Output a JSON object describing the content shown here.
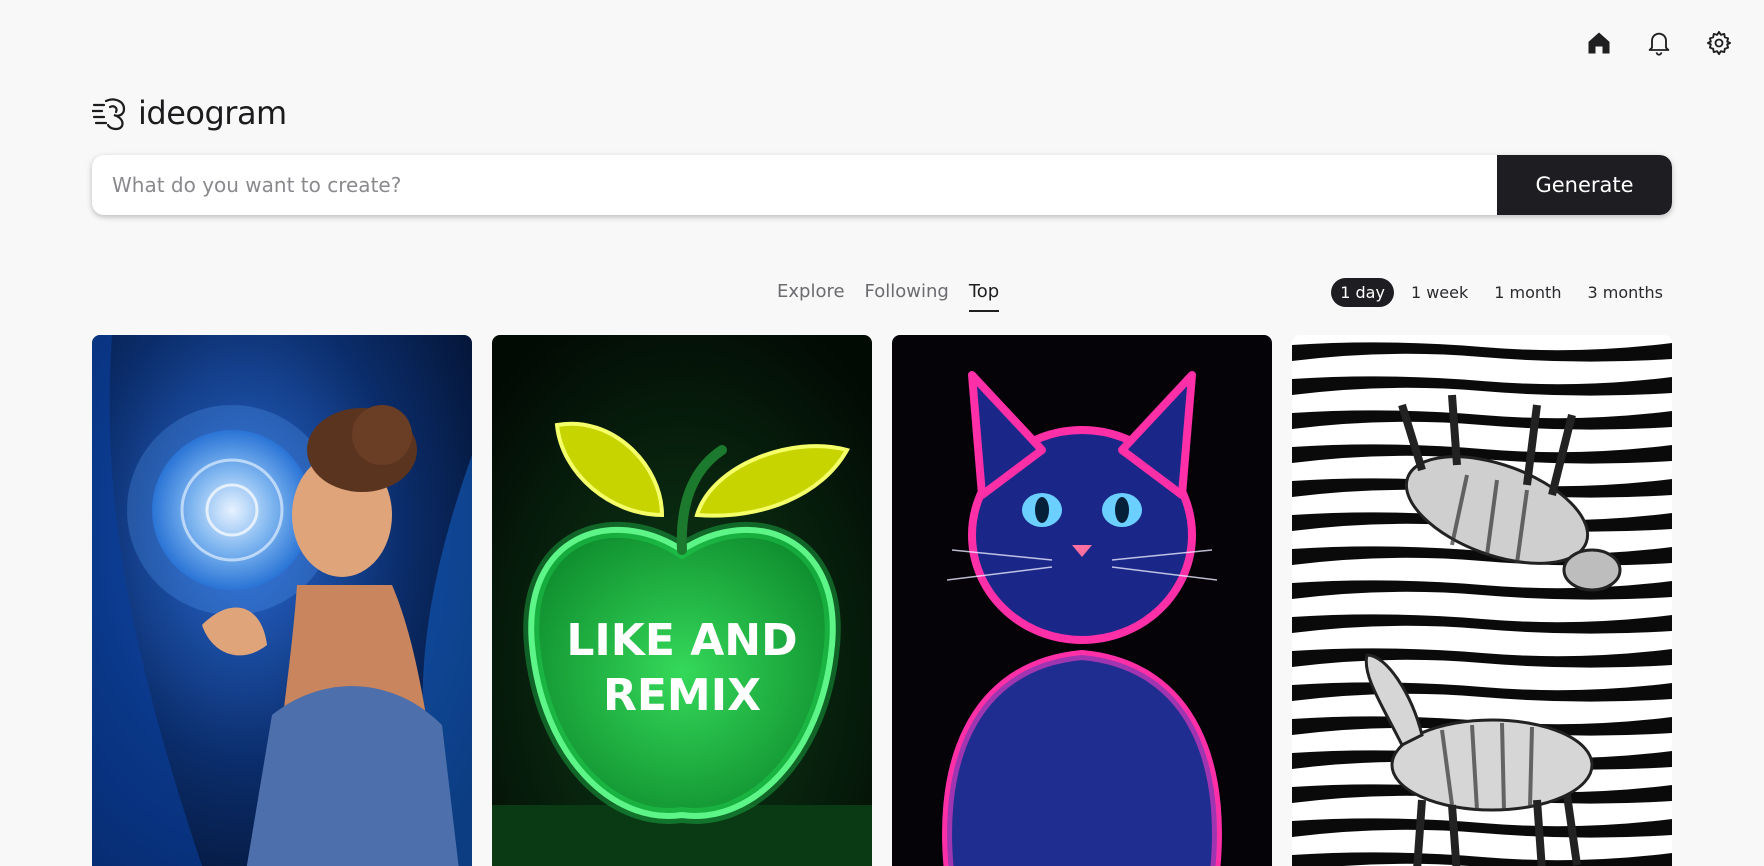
{
  "nav": {
    "icons": [
      "home-icon",
      "bell-icon",
      "gear-icon"
    ]
  },
  "logo": {
    "text": "ideogram"
  },
  "search": {
    "placeholder": "What do you want to create?",
    "value": "",
    "button_label": "Generate"
  },
  "tabs": [
    {
      "label": "Explore",
      "active": false
    },
    {
      "label": "Following",
      "active": false
    },
    {
      "label": "Top",
      "active": true
    }
  ],
  "filters": [
    {
      "label": "1 day",
      "active": true
    },
    {
      "label": "1 week",
      "active": false
    },
    {
      "label": "1 month",
      "active": false
    },
    {
      "label": "3 months",
      "active": false
    }
  ],
  "gallery": {
    "cards": [
      {
        "subject": "woman-with-glowing-rose",
        "accent": "#1e6fd0"
      },
      {
        "subject": "neon-green-apple",
        "accent": "#22e35a",
        "text_line1": "LIKE AND",
        "text_line2": "REMIX"
      },
      {
        "subject": "neon-blue-pink-cat",
        "accent": "#ff2fa8"
      },
      {
        "subject": "zebras-on-stripes",
        "accent": "#000000"
      }
    ]
  },
  "colors": {
    "background": "#f8f8f8",
    "primary_dark": "#1e1e22",
    "muted_text": "#6b6b70"
  }
}
